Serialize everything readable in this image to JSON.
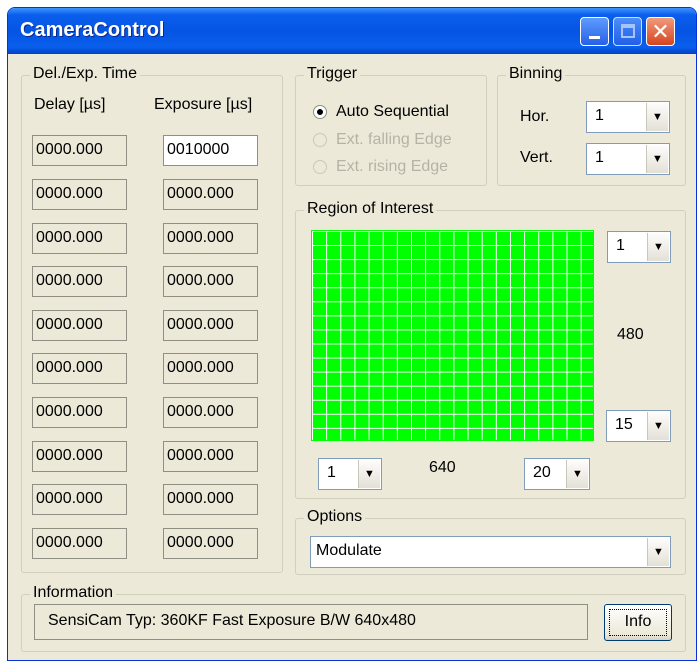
{
  "window": {
    "title": "CameraControl"
  },
  "del_exp": {
    "group_label": "Del./Exp. Time",
    "delay_header": "Delay [µs]",
    "exposure_header": "Exposure [µs]",
    "rows": [
      {
        "delay": "0000.000",
        "exposure": "0010000"
      },
      {
        "delay": "0000.000",
        "exposure": "0000.000"
      },
      {
        "delay": "0000.000",
        "exposure": "0000.000"
      },
      {
        "delay": "0000.000",
        "exposure": "0000.000"
      },
      {
        "delay": "0000.000",
        "exposure": "0000.000"
      },
      {
        "delay": "0000.000",
        "exposure": "0000.000"
      },
      {
        "delay": "0000.000",
        "exposure": "0000.000"
      },
      {
        "delay": "0000.000",
        "exposure": "0000.000"
      },
      {
        "delay": "0000.000",
        "exposure": "0000.000"
      },
      {
        "delay": "0000.000",
        "exposure": "0000.000"
      }
    ]
  },
  "trigger": {
    "group_label": "Trigger",
    "options": [
      {
        "label": "Auto Sequential",
        "selected": true,
        "enabled": true
      },
      {
        "label": "Ext. falling Edge",
        "selected": false,
        "enabled": false
      },
      {
        "label": "Ext. rising Edge",
        "selected": false,
        "enabled": false
      }
    ]
  },
  "binning": {
    "group_label": "Binning",
    "hor_label": "Hor.",
    "hor_value": "1",
    "vert_label": "Vert.",
    "vert_value": "1"
  },
  "roi": {
    "group_label": "Region of Interest",
    "top_value": "1",
    "height_label": "480",
    "bottom_value": "15",
    "left_value": "1",
    "width_label": "640",
    "right_value": "20",
    "grid_color": "#00ff00"
  },
  "options": {
    "group_label": "Options",
    "selected": "Modulate"
  },
  "information": {
    "group_label": "Information",
    "text": "SensiCam Typ: 360KF   Fast Exposure   B/W  640x480",
    "info_button": "Info"
  }
}
